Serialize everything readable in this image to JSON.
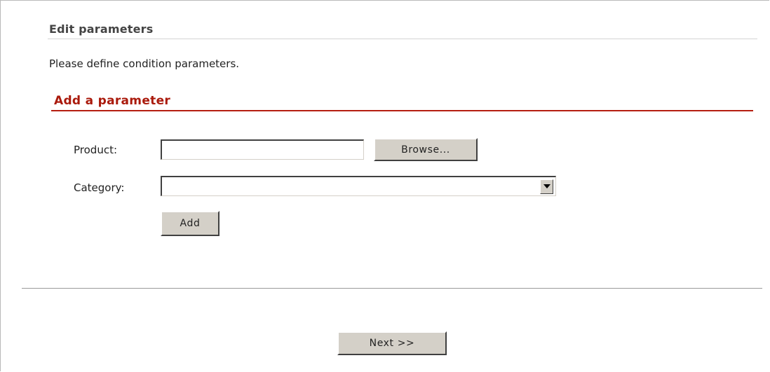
{
  "section": {
    "title": "Edit parameters",
    "intro": "Please define condition parameters."
  },
  "add_parameter": {
    "title": "Add a parameter",
    "product_label": "Product:",
    "product_value": "",
    "browse_label": "Browse...",
    "category_label": "Category:",
    "category_selected": "",
    "add_label": "Add"
  },
  "footer": {
    "next_label": "Next >>"
  },
  "icons": {
    "dropdown": "triangle-down-icon"
  },
  "colors": {
    "accent": "#aa1a0c",
    "button_face": "#d4d0c8",
    "heading": "#444444"
  }
}
